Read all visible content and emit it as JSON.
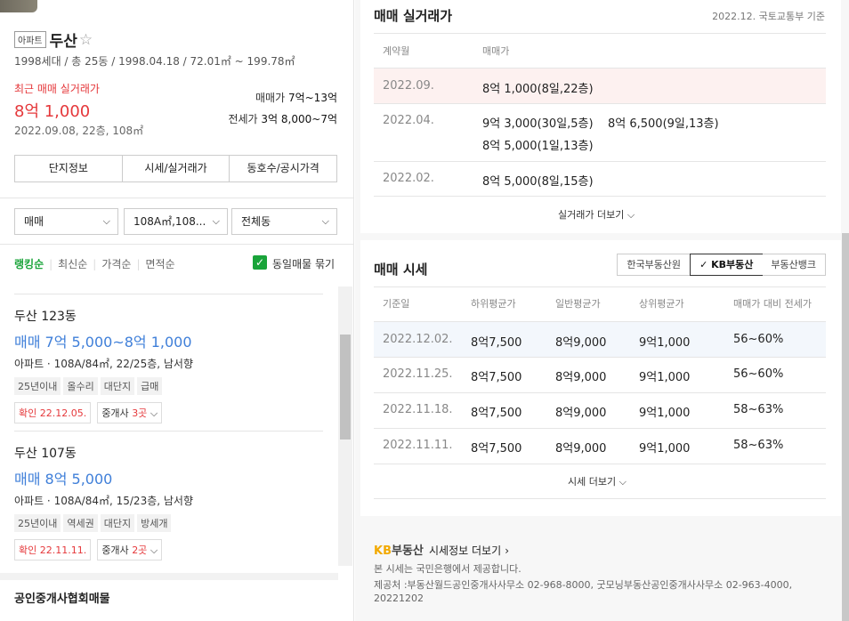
{
  "complex": {
    "type_badge": "아파트",
    "name": "두산",
    "info": "1998세대 / 총 25동 / 1998.04.18 / 72.01㎡ ~ 199.78㎡",
    "recent_label": "최근 매매 실거래가",
    "recent_price": "8억 1,000",
    "recent_detail": "2022.09.08, 22층, 108㎡",
    "sale_label": "매매가",
    "sale_range": "7억~13억",
    "jeonse_label": "전세가",
    "jeonse_range": "3억 8,000~7억"
  },
  "tabs": [
    "단지정보",
    "시세/실거래가",
    "동호수/공시가격"
  ],
  "filters": {
    "trade_type": "매매",
    "area": "108A㎡,108...",
    "building": "전체동"
  },
  "sort": {
    "options": [
      "랭킹순",
      "최신순",
      "가격순",
      "면적순"
    ],
    "active": "랭킹순",
    "group_label": "동일매물 묶기",
    "group_checked": true
  },
  "listings": [
    {
      "title": "두산 123동",
      "price": "매매 7억 5,000~8억 1,000",
      "spec": "아파트 · 108A/84㎡, 22/25층, 남서향",
      "tags": [
        "25년이내",
        "올수리",
        "대단지",
        "급매"
      ],
      "confirmed": "확인 22.12.05.",
      "agent_prefix": "중개사",
      "agent_count": "3곳"
    },
    {
      "title": "두산 107동",
      "price": "매매 8억 5,000",
      "spec": "아파트 · 108A/84㎡, 15/23층, 남서향",
      "tags": [
        "25년이내",
        "역세권",
        "대단지",
        "방세개"
      ],
      "confirmed": "확인 22.11.11.",
      "agent_prefix": "중개사",
      "agent_count": "2곳"
    }
  ],
  "association_title": "공인중개사협회매물",
  "transactions": {
    "title": "매매 실거래가",
    "source": "2022.12. 국토교통부 기준",
    "col_date": "계약월",
    "col_price": "매매가",
    "rows": [
      {
        "date": "2022.09.",
        "prices": [
          "8억 1,000(8일,22층)"
        ]
      },
      {
        "date": "2022.04.",
        "prices": [
          "9억 3,000(30일,5층)",
          "8억 6,500(9일,13층)",
          "8억 5,000(1일,13층)"
        ]
      },
      {
        "date": "2022.02.",
        "prices": [
          "8억 5,000(8일,15층)"
        ]
      }
    ],
    "more": "실거래가 더보기"
  },
  "market": {
    "title": "매매 시세",
    "sources": [
      "한국부동산원",
      "KB부동산",
      "부동산뱅크"
    ],
    "active_source": "KB부동산",
    "columns": [
      "기준일",
      "하위평균가",
      "일반평균가",
      "상위평균가",
      "매매가 대비 전세가"
    ],
    "rows": [
      [
        "2022.12.02.",
        "8억7,500",
        "8억9,000",
        "9억1,000",
        "56~60%"
      ],
      [
        "2022.11.25.",
        "8억7,500",
        "8억9,000",
        "9억1,000",
        "56~60%"
      ],
      [
        "2022.11.18.",
        "8억7,500",
        "8억9,000",
        "9억1,000",
        "58~63%"
      ],
      [
        "2022.11.11.",
        "8억7,500",
        "8억9,000",
        "9억1,000",
        "58~63%"
      ]
    ],
    "more": "시세 더보기"
  },
  "kb": {
    "logo_kb": "KB",
    "logo_text": "부동산",
    "link": "시세정보 더보기",
    "note1": "본 시세는 국민은행에서 제공합니다.",
    "note2": "제공처 :부동산월드공인중개사사무소 02-968-8000, 굿모닝부동산공인중개사사무소 02-963-4000,",
    "note3": "20221202"
  },
  "colors": {
    "accent_green": "#1aa43a",
    "price_red": "#e5383b",
    "price_blue": "#3f7fd9",
    "highlight_row": "#fdf1f0",
    "highlight_row_blue": "#f3f7fc"
  }
}
